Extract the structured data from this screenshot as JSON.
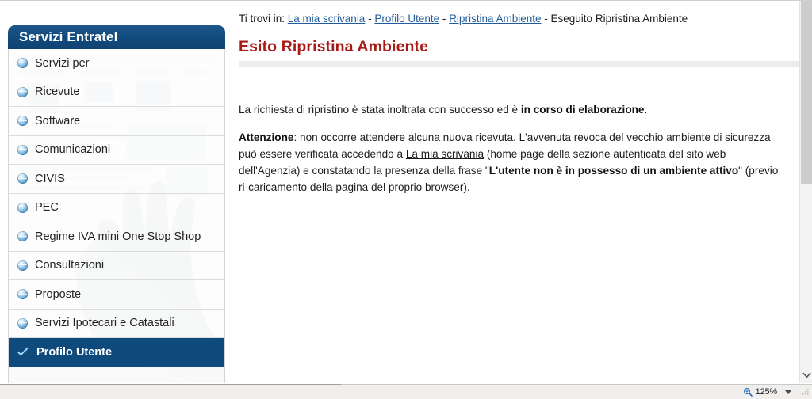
{
  "sidebar": {
    "header_title": "Servizi Entratel",
    "items": [
      {
        "label": "Servizi per",
        "icon": "globe-bullet-icon",
        "selected": false
      },
      {
        "label": "Ricevute",
        "icon": "globe-bullet-icon",
        "selected": false
      },
      {
        "label": "Software",
        "icon": "globe-bullet-icon",
        "selected": false
      },
      {
        "label": "Comunicazioni",
        "icon": "globe-bullet-icon",
        "selected": false
      },
      {
        "label": "CIVIS",
        "icon": "globe-bullet-icon",
        "selected": false
      },
      {
        "label": "PEC",
        "icon": "globe-bullet-icon",
        "selected": false
      },
      {
        "label": "Regime IVA mini One Stop Shop",
        "icon": "globe-bullet-icon",
        "selected": false
      },
      {
        "label": "Consultazioni",
        "icon": "globe-bullet-icon",
        "selected": false
      },
      {
        "label": "Proposte",
        "icon": "globe-bullet-icon",
        "selected": false
      },
      {
        "label": "Servizi Ipotecari e Catastali",
        "icon": "globe-bullet-icon",
        "selected": false
      },
      {
        "label": "Profilo Utente",
        "icon": "checkmark-icon",
        "selected": true
      }
    ]
  },
  "breadcrumb": {
    "prefix": "Ti trovi in:",
    "separator": "-",
    "links": [
      "La mia scrivania",
      "Profilo Utente",
      "Ripristina Ambiente"
    ],
    "current": "Eseguito Ripristina Ambiente"
  },
  "main": {
    "title": "Esito Ripristina Ambiente",
    "paragraph1": {
      "text_before": "La richiesta di ripristino è stata inoltrata con successo ed è ",
      "bold": "in corso di elaborazione",
      "text_after": "."
    },
    "paragraph2": {
      "lead_bold": "Attenzione",
      "s1": ": non occorre attendere alcuna nuova ricevuta. L'avvenuta revoca del vecchio ambiente di sicurezza può essere verificata accedendo a ",
      "link": "La mia scrivania",
      "s2": " (home page della sezione autenticata del sito web dell'Agenzia) e constatando la presenza della frase \"",
      "bold_quote": "L'utente non è in possesso di un ambiente attivo",
      "s3": "\" (previo ri-caricamento della pagina del proprio browser)."
    }
  },
  "statusbar": {
    "zoom_icon": "magnifier-zoom-icon",
    "zoom_level": "125%",
    "dropdown_icon": "chevron-down-icon",
    "grip_icon": "resize-grip-icon"
  },
  "scrollbar": {
    "orientation": "vertical",
    "down_arrow_icon": "chevron-down-icon"
  },
  "colors": {
    "brand_navy": "#0f4a7d",
    "title_red": "#a81b16",
    "link_blue": "#1f5c9e",
    "rule_gray": "#ececec",
    "statusbar_bg": "#f0efee"
  }
}
